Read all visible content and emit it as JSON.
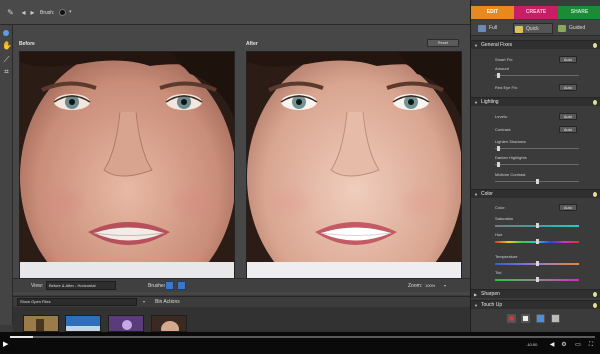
{
  "toolbar": {
    "brush_label": "Brush:"
  },
  "canvas": {
    "before_label": "Before",
    "after_label": "After",
    "reset_label": "Reset"
  },
  "view": {
    "label": "View:",
    "selected": "Before & After - Horizontal",
    "brushes_label": "Brushes:",
    "zoom_label": "Zoom:",
    "zoom_value": "100%"
  },
  "bin": {
    "show_label": "Show Open Files",
    "actions_label": "Bin Actions"
  },
  "tabs": [
    {
      "label": "EDIT",
      "color": "#e8891f",
      "active": true
    },
    {
      "label": "CREATE",
      "color": "#c81e65",
      "active": false
    },
    {
      "label": "SHARE",
      "color": "#1d8a35",
      "active": false
    }
  ],
  "modes": [
    {
      "label": "Full",
      "active": false
    },
    {
      "label": "Quick",
      "active": true
    },
    {
      "label": "Guided",
      "active": false
    }
  ],
  "sections": {
    "general_fixes": {
      "title": "General Fixes",
      "smart_fix": "Smart Fix:",
      "amount": "Amount",
      "red_eye": "Red Eye Fix:"
    },
    "lighting": {
      "title": "Lighting",
      "levels": "Levels:",
      "contrast": "Contrast:",
      "lighten_shadows": "Lighten Shadows",
      "darken_highlights": "Darken Highlights",
      "midtone_contrast": "Midtone Contrast"
    },
    "color": {
      "title": "Color",
      "color_label": "Color:",
      "saturation": "Saturation",
      "hue": "Hue",
      "temperature": "Temperature",
      "tint": "Tint"
    },
    "sharpen": {
      "title": "Sharpen"
    },
    "touch_up": {
      "title": "Touch Up"
    }
  },
  "auto_label": "Auto",
  "player": {
    "progress_fraction": 0.04,
    "time": "-10:00"
  }
}
